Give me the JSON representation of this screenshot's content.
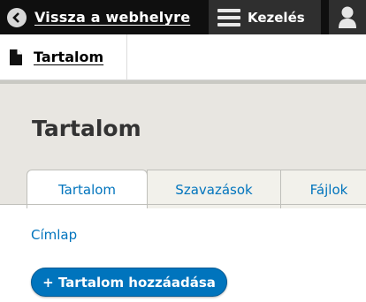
{
  "toolbar": {
    "back_label": "Vissza a webhelyre",
    "manage_label": "Kezelés"
  },
  "tray": {
    "content_label": "Tartalom"
  },
  "page": {
    "title": "Tartalom"
  },
  "tabs": [
    {
      "label": "Tartalom",
      "active": true
    },
    {
      "label": "Szavazások",
      "active": false
    },
    {
      "label": "Fájlok",
      "active": false
    }
  ],
  "breadcrumb": {
    "home_label": "Címlap"
  },
  "actions": {
    "add_content_label": "+ Tartalom hozzáadása"
  },
  "colors": {
    "link": "#0074bd",
    "toolbar_bg": "#0f0f0f",
    "header_bg": "#e8e6e1"
  }
}
